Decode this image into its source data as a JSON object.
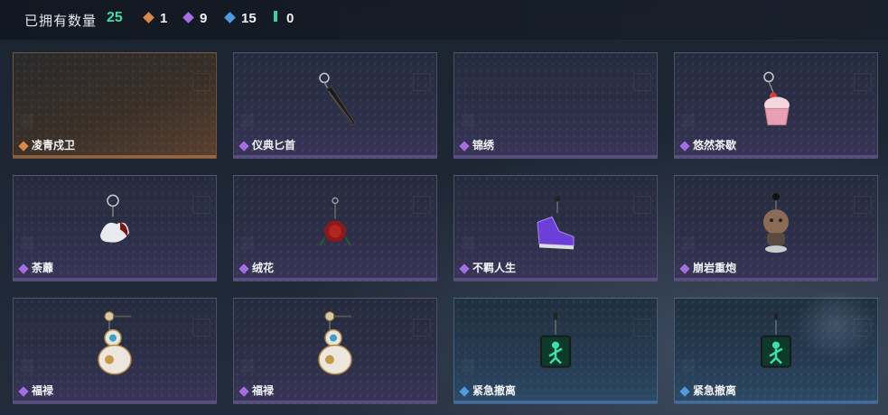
{
  "header": {
    "owned_label": "已拥有数量",
    "owned_count": "25",
    "stats": [
      {
        "icon": "orange-rarity-icon",
        "color": "#d9884a",
        "value": "1"
      },
      {
        "icon": "purple-rarity-icon",
        "color": "#a66ee0",
        "value": "9"
      },
      {
        "icon": "blue-rarity-icon",
        "color": "#4f9be0",
        "value": "15"
      },
      {
        "icon": "green-rarity-icon",
        "color": "#37d39a",
        "value": "0"
      }
    ]
  },
  "items": [
    {
      "name": "凌青戍卫",
      "rarity": "orange",
      "icon": "empty"
    },
    {
      "name": "仪典匕首",
      "rarity": "purple",
      "icon": "dagger-charm-icon"
    },
    {
      "name": "锦绣",
      "rarity": "purple",
      "icon": "empty"
    },
    {
      "name": "悠然茶歇",
      "rarity": "purple",
      "icon": "cupcake-charm-icon"
    },
    {
      "name": "荼蘼",
      "rarity": "purple",
      "icon": "white-creature-charm-icon"
    },
    {
      "name": "绒花",
      "rarity": "purple",
      "icon": "rose-charm-icon"
    },
    {
      "name": "不羁人生",
      "rarity": "purple",
      "icon": "sneaker-charm-icon"
    },
    {
      "name": "崩岩重炮",
      "rarity": "purple",
      "icon": "doll-charm-icon"
    },
    {
      "name": "福禄",
      "rarity": "purple",
      "icon": "gourd-charm-icon"
    },
    {
      "name": "福禄",
      "rarity": "purple",
      "icon": "gourd-charm-icon"
    },
    {
      "name": "紧急撤离",
      "rarity": "blue",
      "icon": "exit-sign-charm-icon"
    },
    {
      "name": "紧急撤离",
      "rarity": "blue",
      "icon": "exit-sign-charm-icon"
    }
  ],
  "rarity_colors": {
    "orange": "#d9884a",
    "purple": "#a66ee0",
    "blue": "#4f9be0",
    "green": "#37d39a"
  }
}
